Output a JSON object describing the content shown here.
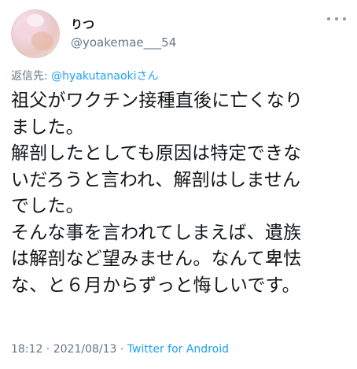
{
  "tweet": {
    "display_name": "りつ",
    "handle": "@yoakemae___54",
    "reply_prefix": "返信先: ",
    "reply_mention": "@hyakutanaoki",
    "reply_suffix": "さん",
    "lines": [
      "祖父がワクチン接種直後に亡くなり",
      "ました。",
      "解剖したとしても原因は特定できな",
      "いだろうと言われ、解剖はしません",
      "でした。",
      "そんな事を言われてしまえば、遺族",
      "は解剖など望みません。なんて卑怯",
      "な、と６月からずっと悔しいです。"
    ],
    "time": "18:12",
    "date": "2021/08/13",
    "separator": " · ",
    "source": "Twitter for Android"
  },
  "icons": {
    "more": "more-horizontal-icon"
  },
  "colors": {
    "text": "#14171a",
    "secondary": "#657786",
    "link": "#1da1f2"
  }
}
